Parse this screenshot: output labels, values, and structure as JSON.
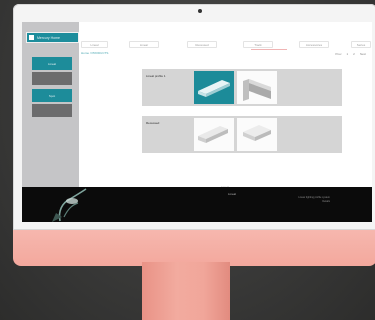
{
  "sidebar": {
    "logo_text": "Mercury Home",
    "buttons": [
      {
        "label": "Lineal",
        "style": "teal"
      },
      {
        "label": "",
        "style": "gray"
      },
      {
        "label": "Spot",
        "style": "teal"
      },
      {
        "label": "",
        "style": "gray"
      }
    ]
  },
  "tabs": [
    "Lineal",
    "Linear",
    "Recessed",
    "Track",
    "Accessories",
    "Series"
  ],
  "breadcrumb": "Home / PRODUCTS",
  "pagination": [
    "Prev",
    "1",
    "2",
    "Next"
  ],
  "products": [
    {
      "label": "Lineal profile 1"
    },
    {
      "label": "Recessed"
    }
  ],
  "footer_note": "Lineal",
  "banner": {
    "caption": "Lineal",
    "lines": [
      "Linear lighting profile system",
      "Details"
    ]
  },
  "colors": {
    "accent": "#1d8c9a",
    "sidebar_bg": "#c5c5c7",
    "chin": "#f3a89d",
    "panel_bg": "#d5d5d5"
  }
}
